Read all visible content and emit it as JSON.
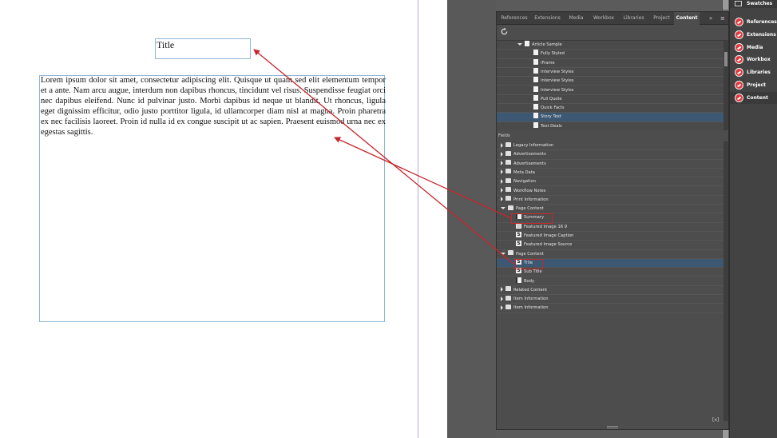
{
  "document": {
    "title_text": "Title",
    "body_text": "Lorem ipsum dolor sit amet, consectetur adipiscing elit. Quisque ut quam sed elit elementum tempor et a ante. Nam arcu augue, interdum non dapibus rhoncus, tincidunt vel risus. Suspendisse feugiat orci nec dapibus eleifend. Nunc id pulvinar justo. Morbi dapibus id neque ut blandit. Ut rhoncus, ligula eget dignissim efficitur, odio justo porttitor ligula, id ullamcorper diam nisl at magna. Proin pharetra ex nec facilisis laoreet. Proin id nulla id ex congue suscipit ut ac sapien. Praesent euismod urna nec ex egestas sagittis."
  },
  "panel": {
    "tabs": [
      {
        "label": "References"
      },
      {
        "label": "Extensions"
      },
      {
        "label": "Media"
      },
      {
        "label": "Workbox"
      },
      {
        "label": "Libraries"
      },
      {
        "label": "Project"
      },
      {
        "label": "Content"
      }
    ],
    "active_tab": "Content",
    "tab_more": "»",
    "tab_menu": "≡",
    "content_items": [
      {
        "label": "Article Sample",
        "kind": "parent"
      },
      {
        "label": "Fully Styled",
        "kind": "child"
      },
      {
        "label": "iFrame",
        "kind": "child"
      },
      {
        "label": "Interview Styles",
        "kind": "child"
      },
      {
        "label": "Interview Styles",
        "kind": "child"
      },
      {
        "label": "Interview Styles",
        "kind": "child"
      },
      {
        "label": "Pull Quote",
        "kind": "child"
      },
      {
        "label": "Quick Facts",
        "kind": "child"
      },
      {
        "label": "Story Text",
        "kind": "child",
        "selected": true
      },
      {
        "label": "Text Deals",
        "kind": "child"
      }
    ],
    "fields_label": "Fields",
    "fields": [
      {
        "label": "Legacy Information",
        "kind": "group",
        "expanded": false
      },
      {
        "label": "Advertisements",
        "kind": "group",
        "expanded": false
      },
      {
        "label": "Advertisements",
        "kind": "group",
        "expanded": false
      },
      {
        "label": "Meta Data",
        "kind": "group",
        "expanded": false
      },
      {
        "label": "Navigation",
        "kind": "group",
        "expanded": false
      },
      {
        "label": "Workflow Notes",
        "kind": "group",
        "expanded": false
      },
      {
        "label": "Print Information",
        "kind": "group",
        "expanded": false
      },
      {
        "label": "Page Content",
        "kind": "group",
        "expanded": true
      },
      {
        "label": "Summary",
        "kind": "rt"
      },
      {
        "label": "Featured Image 16 9",
        "kind": "img"
      },
      {
        "label": "Featured Image Caption",
        "kind": "s"
      },
      {
        "label": "Featured Image Source",
        "kind": "s"
      },
      {
        "label": "Page Content",
        "kind": "group",
        "expanded": true
      },
      {
        "label": "Title",
        "kind": "s",
        "selected": true
      },
      {
        "label": "Sub Title",
        "kind": "s"
      },
      {
        "label": "Body",
        "kind": "rt"
      },
      {
        "label": "Related Content",
        "kind": "group",
        "expanded": false
      },
      {
        "label": "Item Information",
        "kind": "group",
        "expanded": false
      },
      {
        "label": "Item Information",
        "kind": "group",
        "expanded": false
      }
    ],
    "var_button": "[x]"
  },
  "dock": {
    "swatches_label": "Swatches",
    "items": [
      {
        "label": "References"
      },
      {
        "label": "Extensions"
      },
      {
        "label": "Media"
      },
      {
        "label": "Workbox"
      },
      {
        "label": "Libraries"
      },
      {
        "label": "Project"
      },
      {
        "label": "Content",
        "active": true
      }
    ]
  },
  "colors": {
    "annotation_red": "#c8262c",
    "frame_blue": "#8fb6d8",
    "selection_blue": "#3c5873",
    "dock_icon_red": "#e03a3e"
  }
}
